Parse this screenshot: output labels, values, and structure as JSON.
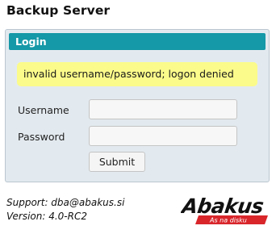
{
  "page": {
    "title": "Backup Server"
  },
  "login": {
    "header": "Login",
    "error_message": "invalid username/password; logon denied",
    "username_label": "Username",
    "username_value": "",
    "password_label": "Password",
    "password_value": "",
    "submit_label": "Submit"
  },
  "footer": {
    "support": "Support: dba@abakus.si",
    "version": "Version: 4.0-RC2"
  },
  "logo": {
    "name": "Abakus",
    "tagline": "As na disku"
  },
  "colors": {
    "header_bg": "#1598a7",
    "error_bg": "#fbfb8b",
    "panel_bg": "#e3eaef",
    "logo_red": "#d8262b"
  }
}
